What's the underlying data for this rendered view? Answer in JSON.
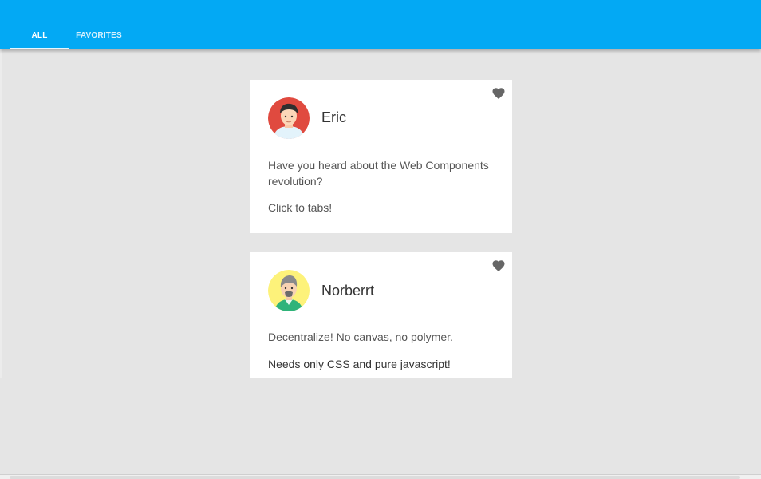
{
  "app": {
    "accent_color": "#03a9f4",
    "background_color": "#e5e5e5"
  },
  "tabs": [
    {
      "label": "ALL",
      "selected": true
    },
    {
      "label": "FAVORITES",
      "selected": false
    }
  ],
  "posts": [
    {
      "author": "Eric",
      "avatar_icon": "avatar-eric-icon",
      "favorite_icon": "heart-icon",
      "paragraphs": [
        "Have you heard about the Web Components revolution?",
        "Click to tabs!"
      ]
    },
    {
      "author": "Norberrt",
      "avatar_icon": "avatar-norberrt-icon",
      "favorite_icon": "heart-icon",
      "paragraphs": [
        "Decentralize! No canvas, no polymer.",
        "Needs only CSS and pure javascript!"
      ]
    }
  ]
}
